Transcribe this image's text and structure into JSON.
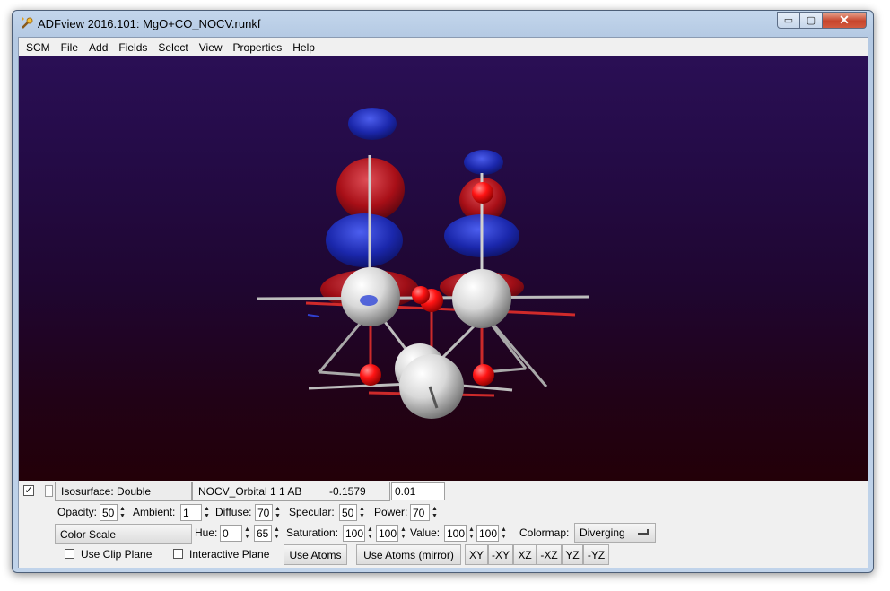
{
  "window": {
    "title": "ADFview 2016.101: MgO+CO_NOCV.runkf",
    "minimize_glyph": "▭",
    "maximize_glyph": "▢",
    "close_glyph": "✕"
  },
  "menu": [
    "SCM",
    "File",
    "Add",
    "Fields",
    "Select",
    "View",
    "Properties",
    "Help"
  ],
  "colors": {
    "positive_lobe": "#d41010",
    "negative_lobe": "#1c2eb0",
    "oxygen_atom": "#ff0a0a",
    "magnesium_atom": "#e6e6e6"
  },
  "panel": {
    "visible_checked": "✓",
    "isosurface_label": "Isosurface: Double",
    "field_name": "NOCV_Orbital 1 1 AB",
    "field_value": "-0.1579",
    "iso_value": "0.01",
    "opacity_label": "Opacity:",
    "opacity": "50",
    "ambient_label": "Ambient:",
    "ambient": "1",
    "diffuse_label": "Diffuse:",
    "diffuse": "70",
    "specular_label": "Specular:",
    "specular": "50",
    "power_label": "Power:",
    "power": "70",
    "color_scale_label": "Color Scale",
    "hue_label": "Hue:",
    "hue_1": "0",
    "hue_2": "65",
    "saturation_label": "Saturation:",
    "saturation_1": "100",
    "saturation_2": "100",
    "value_label": "Value:",
    "value_1": "100",
    "value_2": "100",
    "colormap_label": "Colormap:",
    "colormap": "Diverging",
    "use_clip_plane": "Use Clip Plane",
    "interactive_plane": "Interactive Plane",
    "use_atoms": "Use Atoms",
    "use_atoms_mirror": "Use Atoms (mirror)",
    "axis_buttons": [
      "XY",
      "-XY",
      "XZ",
      "-XZ",
      "YZ",
      "-YZ"
    ]
  }
}
